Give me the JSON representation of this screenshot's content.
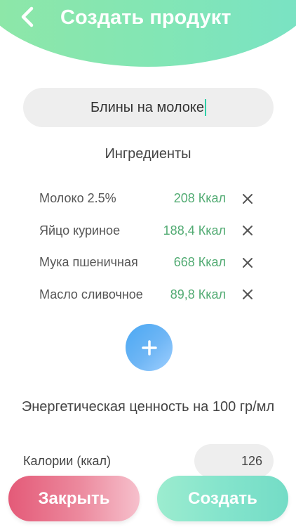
{
  "header": {
    "title": "Создать продукт"
  },
  "product": {
    "name": "Блины на молоке"
  },
  "ingredients": {
    "title": "Ингредиенты",
    "items": [
      {
        "name": "Молоко 2.5%",
        "kcal": "208 Ккал"
      },
      {
        "name": "Яйцо куриное",
        "kcal": "188,4 Ккал"
      },
      {
        "name": "Мука пшеничная",
        "kcal": "668 Ккал"
      },
      {
        "name": "Масло сливочное",
        "kcal": "89,8 Ккал"
      }
    ],
    "remove_icon": "close-icon",
    "add_icon": "plus-icon"
  },
  "energy": {
    "title": "Энергетическая ценность на 100 гр/мл",
    "calories_label": "Калории (ккал)",
    "calories_value": "126"
  },
  "actions": {
    "close_label": "Закрыть",
    "create_label": "Создать"
  },
  "colors": {
    "header_green": "#83e6b4",
    "kcal_green": "#52ab73",
    "add_blue": "#4aa8f3",
    "close_pink": "#e45a78",
    "create_mint": "#84e4cc"
  }
}
